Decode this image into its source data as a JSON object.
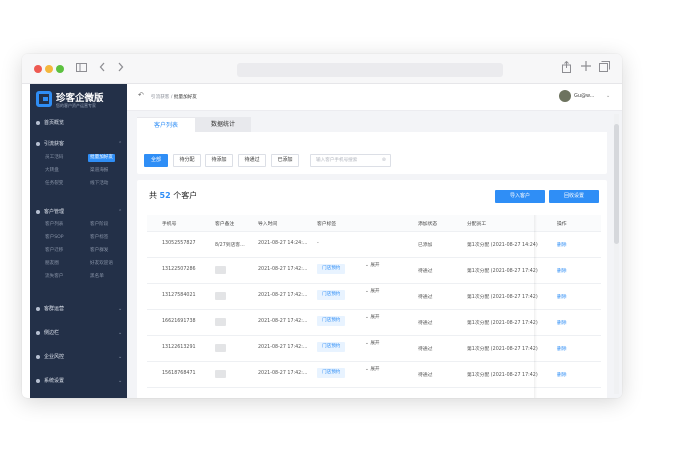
{
  "sidebar": {
    "logo_title": "珍客企微版",
    "logo_subtitle": "您的客户资产运营专家",
    "items": [
      {
        "label": "首页概览",
        "top": 0,
        "icon": "home-icon"
      },
      {
        "label": "引流获客",
        "icon": "funnel-icon"
      },
      {
        "label": "客户管理",
        "icon": "users-icon"
      },
      {
        "label": "客群运营",
        "icon": "group-icon"
      },
      {
        "label": "侧边栏",
        "icon": "sidebar-icon"
      },
      {
        "label": "企业风控",
        "icon": "shield-icon"
      },
      {
        "label": "系统设置",
        "icon": "gear-icon"
      }
    ],
    "acquire_subs": [
      "员工活码",
      "批量加好友",
      "大转盘",
      "渠道海报",
      "任务裂变",
      "线下活动"
    ],
    "customer_subs": [
      "客户列表",
      "客户阶段",
      "客户SOP",
      "客户标签",
      "客户迁移",
      "客户群发",
      "朋友圈",
      "好友欢迎语",
      "流失客户",
      "黑名单"
    ]
  },
  "topbar": {
    "crumb_parent": "引流获客",
    "crumb_sep": "/",
    "crumb_current": "批量加好友",
    "user_name": "Gu@w..."
  },
  "tabs": [
    "客户列表",
    "数据统计"
  ],
  "filters": [
    "全部",
    "待分配",
    "待添加",
    "待通过",
    "已添加"
  ],
  "search_placeholder": "输入客户手机号搜索",
  "summary": {
    "prefix": "共",
    "count": "52",
    "suffix": "个客户"
  },
  "buttons": {
    "import": "导入客户",
    "recycle": "回收设置"
  },
  "table": {
    "headers": [
      "手机号",
      "客户备注",
      "导入时间",
      "客户标签",
      "添加状态",
      "分配员工",
      "操作"
    ],
    "rows": [
      {
        "phone": "13052557827",
        "remark": "8/27到店客...",
        "time": "2021-08-27 14:24:...",
        "tag": "",
        "tag_dash": "-",
        "expand": "",
        "status": "已添加",
        "staff": "第1次分配 (2021-08-27 14:24)",
        "action": "删除"
      },
      {
        "phone": "13122507286",
        "remark": "",
        "time": "2021-08-27 17:42:...",
        "tag": "门店预约",
        "expand": "展开",
        "status": "待通过",
        "staff": "第1次分配 (2021-08-27 17:42)",
        "action": "删除"
      },
      {
        "phone": "13127584021",
        "remark": "",
        "time": "2021-08-27 17:42:...",
        "tag": "门店预约",
        "expand": "展开",
        "status": "待通过",
        "staff": "第1次分配 (2021-08-27 17:42)",
        "action": "删除"
      },
      {
        "phone": "16621691738",
        "remark": "",
        "time": "2021-08-27 17:42:...",
        "tag": "门店预约",
        "expand": "展开",
        "status": "待通过",
        "staff": "第1次分配 (2021-08-27 17:42)",
        "action": "删除"
      },
      {
        "phone": "13122613291",
        "remark": "",
        "time": "2021-08-27 17:42:...",
        "tag": "门店预约",
        "expand": "展开",
        "status": "待通过",
        "staff": "第1次分配 (2021-08-27 17:42)",
        "action": "删除"
      },
      {
        "phone": "15618768471",
        "remark": "",
        "time": "2021-08-27 17:42:...",
        "tag": "门店预约",
        "expand": "展开",
        "status": "待通过",
        "staff": "第1次分配 (2021-08-27 17:42)",
        "action": "删除"
      }
    ]
  },
  "colors": {
    "accent": "#2f8ef6",
    "sidebar": "#233048",
    "tag_bg": "#e8f3ff"
  }
}
